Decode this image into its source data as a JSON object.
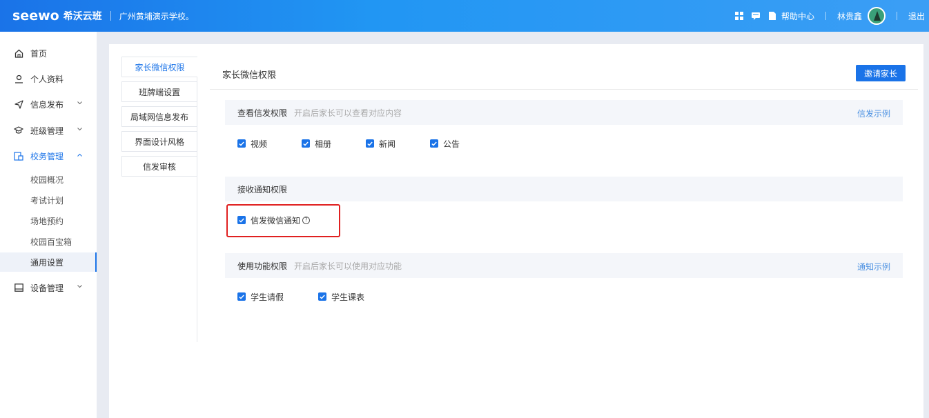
{
  "header": {
    "brand_logo": "seewo",
    "brand_name": "希沃云班",
    "school": "广州黄埔演示学校。",
    "help_label": "帮助中心",
    "user_name": "林贵鑫",
    "logout_label": "退出"
  },
  "sidebar": {
    "items": [
      {
        "label": "首页",
        "icon": "home-icon"
      },
      {
        "label": "个人资料",
        "icon": "user-icon"
      },
      {
        "label": "信息发布",
        "icon": "send-icon"
      },
      {
        "label": "班级管理",
        "icon": "graduation-cap-icon"
      },
      {
        "label": "校务管理",
        "icon": "school-admin-icon"
      },
      {
        "label": "设备管理",
        "icon": "monitor-icon"
      }
    ],
    "sub_items": [
      {
        "label": "校园概况"
      },
      {
        "label": "考试计划"
      },
      {
        "label": "场地预约"
      },
      {
        "label": "校园百宝箱"
      },
      {
        "label": "通用设置"
      }
    ]
  },
  "tabs": [
    {
      "label": "家长微信权限"
    },
    {
      "label": "班牌端设置"
    },
    {
      "label": "局域网信息发布"
    },
    {
      "label": "界面设计风格"
    },
    {
      "label": "信发审核"
    }
  ],
  "panel": {
    "title": "家长微信权限",
    "invite_button": "邀请家长",
    "sections": [
      {
        "title": "查看信发权限",
        "desc": "开启后家长可以查看对应内容",
        "link": "信发示例",
        "options": [
          {
            "label": "视频",
            "checked": true
          },
          {
            "label": "相册",
            "checked": true
          },
          {
            "label": "新闻",
            "checked": true
          },
          {
            "label": "公告",
            "checked": true
          }
        ]
      },
      {
        "title": "接收通知权限",
        "desc": "",
        "link": "",
        "options": [
          {
            "label": "信发微信通知",
            "checked": true
          }
        ]
      },
      {
        "title": "使用功能权限",
        "desc": "开启后家长可以使用对应功能",
        "link": "通知示例",
        "options": [
          {
            "label": "学生请假",
            "checked": true
          },
          {
            "label": "学生课表",
            "checked": true
          }
        ]
      }
    ]
  },
  "colors": {
    "primary": "#1a73e8",
    "highlight": "#e02020",
    "section_bg": "#f4f6fa"
  }
}
